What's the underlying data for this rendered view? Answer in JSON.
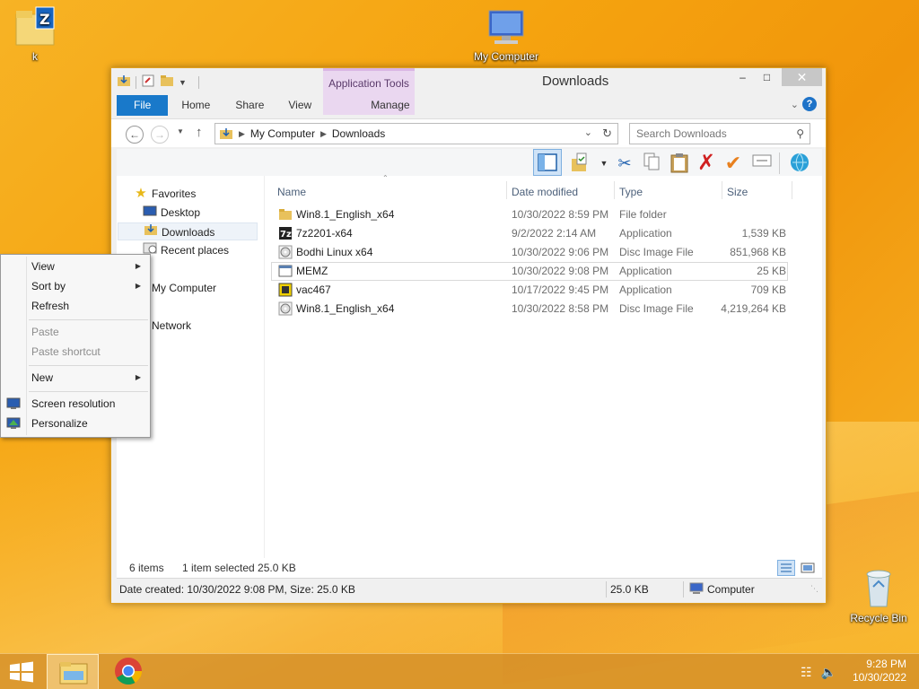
{
  "desktop": {
    "icons": [
      {
        "label": "k",
        "icon": "zip-folder-icon"
      },
      {
        "label": "My Computer",
        "icon": "computer-icon"
      },
      {
        "label": "Recycle Bin",
        "icon": "recycle-bin-icon"
      }
    ]
  },
  "window": {
    "title": "Downloads",
    "context_tab": "Application Tools",
    "ribbon_tabs": [
      "File",
      "Home",
      "Share",
      "View",
      "Manage"
    ],
    "controls": {
      "minimize": "–",
      "maximize": "□",
      "close": "✕"
    },
    "help": "?",
    "address": {
      "crumbs": [
        "My Computer",
        "Downloads"
      ],
      "search_placeholder": "Search Downloads"
    },
    "nav_pane": {
      "items": [
        {
          "label": "Favorites",
          "icon": "star-icon",
          "indent": 0
        },
        {
          "label": "Desktop",
          "icon": "desktop-icon",
          "indent": 1
        },
        {
          "label": "Downloads",
          "icon": "downloads-folder-icon",
          "indent": 1,
          "selected": true
        },
        {
          "label": "Recent places",
          "icon": "recent-places-icon",
          "indent": 1
        },
        {
          "label": "My Computer",
          "icon": "computer-icon",
          "indent": 0
        },
        {
          "label": "Network",
          "icon": "network-icon",
          "indent": 0
        }
      ]
    },
    "columns": [
      "Name",
      "Date modified",
      "Type",
      "Size"
    ],
    "files": [
      {
        "name": "Win8.1_English_x64",
        "date": "10/30/2022 8:59 PM",
        "type": "File folder",
        "size": "",
        "icon": "folder-icon"
      },
      {
        "name": "7z2201-x64",
        "date": "9/2/2022 2:14 AM",
        "type": "Application",
        "size": "1,539 KB",
        "icon": "7zip-icon"
      },
      {
        "name": "Bodhi Linux x64",
        "date": "10/30/2022 9:06 PM",
        "type": "Disc Image File",
        "size": "851,968 KB",
        "icon": "disc-image-icon"
      },
      {
        "name": "MEMZ",
        "date": "10/30/2022 9:08 PM",
        "type": "Application",
        "size": "25 KB",
        "icon": "application-icon",
        "selected": true
      },
      {
        "name": "vac467",
        "date": "10/17/2022 9:45 PM",
        "type": "Application",
        "size": "709 KB",
        "icon": "vac-icon"
      },
      {
        "name": "Win8.1_English_x64",
        "date": "10/30/2022 8:58 PM",
        "type": "Disc Image File",
        "size": "4,219,264 KB",
        "icon": "disc-image-icon"
      }
    ],
    "status": {
      "items": "6 items",
      "selected": "1 item selected  25.0 KB"
    },
    "details": {
      "info": "Date created: 10/30/2022 9:08 PM, Size: 25.0 KB",
      "size": "25.0 KB",
      "location": "Computer"
    }
  },
  "context_menu": {
    "items": [
      {
        "label": "View",
        "submenu": true,
        "disabled": false
      },
      {
        "label": "Sort by",
        "submenu": true,
        "disabled": false
      },
      {
        "label": "Refresh",
        "submenu": false,
        "disabled": false
      },
      {
        "label": "Paste",
        "submenu": false,
        "disabled": true
      },
      {
        "label": "Paste shortcut",
        "submenu": false,
        "disabled": true
      },
      {
        "label": "New",
        "submenu": true,
        "disabled": false
      },
      {
        "label": "Screen resolution",
        "submenu": false,
        "disabled": false,
        "icon": "screen-resolution-icon"
      },
      {
        "label": "Personalize",
        "submenu": false,
        "disabled": false,
        "icon": "personalize-icon"
      }
    ]
  },
  "taskbar": {
    "apps": [
      "file-explorer-icon",
      "chrome-icon"
    ],
    "time": "9:28 PM",
    "date": "10/30/2022"
  },
  "colors": {
    "accent": "#1979ca",
    "wallpaper": "#f5a30f"
  }
}
